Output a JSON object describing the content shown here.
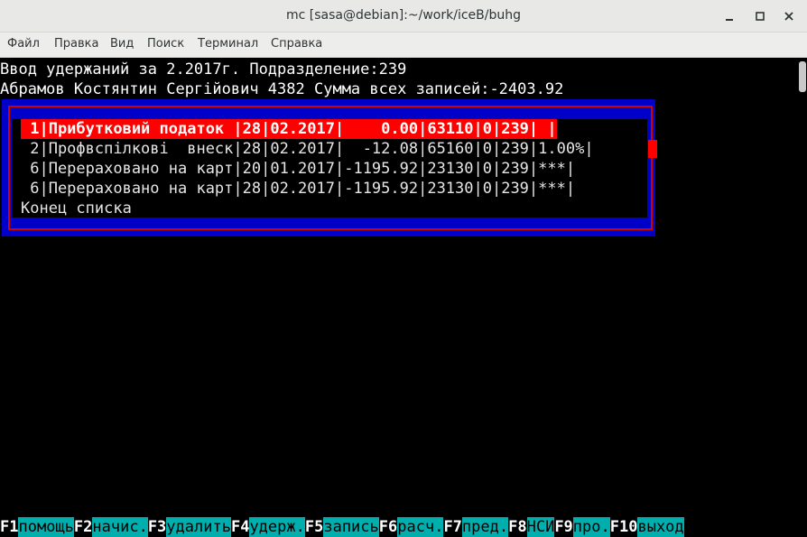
{
  "window": {
    "title": "mc [sasa@debian]:~/work/iceB/buhg"
  },
  "menu": {
    "items": [
      {
        "label": "Файл"
      },
      {
        "label": "Правка"
      },
      {
        "label": "Вид"
      },
      {
        "label": "Поиск"
      },
      {
        "label": "Терминал"
      },
      {
        "label": "Справка"
      }
    ]
  },
  "terminal": {
    "header_line1": "Ввод удержаний за 2.2017г. Подразделение:239",
    "header_line2": "Абрамов Костянтин Сергійович 4382 Сумма всех записей:-2403.92",
    "rows": [
      {
        "text": " 1|Прибутковий податок |28|02.2017|    0.00|63110|0|239| |",
        "selected": true
      },
      {
        "text": " 2|Профвспілкові  внеск|28|02.2017|  -12.08|65160|0|239|1.00%|",
        "selected": false
      },
      {
        "text": " 6|Перераховано на карт|20|01.2017|-1195.92|23130|0|239|***|",
        "selected": false
      },
      {
        "text": " 6|Перераховано на карт|28|02.2017|-1195.92|23130|0|239|***|",
        "selected": false
      }
    ],
    "list_end": "Конец списка"
  },
  "fkeys": [
    {
      "key": "F1",
      "label": "помощь"
    },
    {
      "key": "F2",
      "label": "начис."
    },
    {
      "key": "F3",
      "label": "удалить"
    },
    {
      "key": "F4",
      "label": "удерж."
    },
    {
      "key": "F5",
      "label": "запись"
    },
    {
      "key": "F6",
      "label": "расч."
    },
    {
      "key": "F7",
      "label": "пред."
    },
    {
      "key": "F8",
      "label": "НСИ"
    },
    {
      "key": "F9",
      "label": "про."
    },
    {
      "key": "F10",
      "label": "выход"
    }
  ],
  "colors": {
    "terminal_bg": "#000000",
    "dialog_bg": "#0000c8",
    "dialog_border": "#d20000",
    "selected_row": "#ff0000",
    "fkey_label_bg": "#00aeae"
  }
}
